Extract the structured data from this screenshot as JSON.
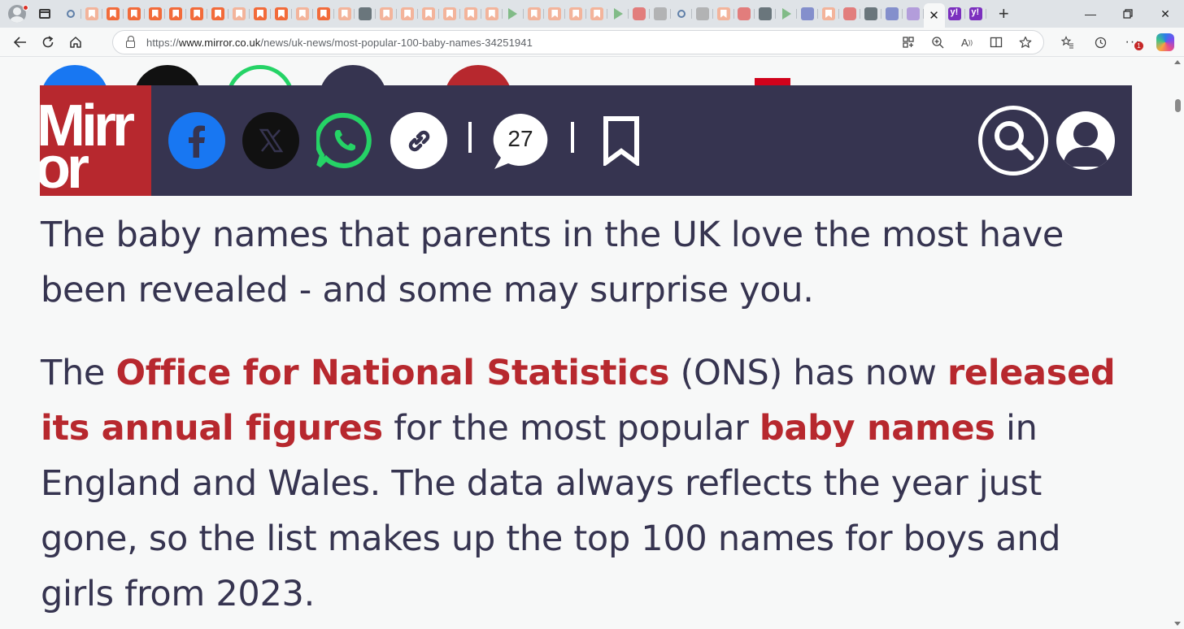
{
  "browser": {
    "tab_count": 46,
    "active_tab_close": "✕",
    "new_tab_label": "+",
    "url_prefix": "https://",
    "url_host": "www.mirror.co.uk",
    "url_path": "/news/uk-news/most-popular-100-baby-names-34251941",
    "notification_count": "1"
  },
  "header": {
    "logo_line1": "Mirr",
    "logo_line2": "or",
    "comment_count": "27",
    "colors": {
      "header_bg": "#363450",
      "brand_red": "#b7282e",
      "facebook_blue": "#1877f2",
      "whatsapp_green": "#25d366"
    }
  },
  "article": {
    "p1": "The baby names that parents in the UK love the most have been revealed - and some may surprise you.",
    "p2": {
      "t1": "The ",
      "link1": "Office for National Statistics",
      "t2": " (ONS) has now ",
      "link2": "released its annual figures",
      "t3": " for the most popular ",
      "link3": "baby names",
      "t4": " in England and Wales. The data always reflects the year just gone, so the list makes up the top 100 names for boys and girls from 2023."
    }
  }
}
